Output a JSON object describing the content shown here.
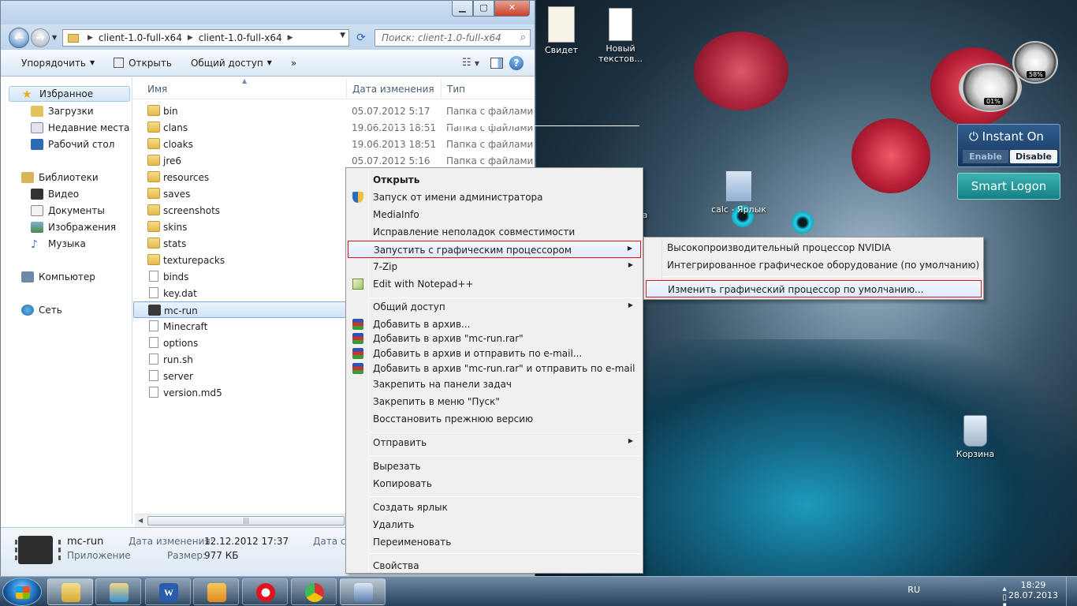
{
  "window": {
    "address": [
      "client-1.0-full-x64",
      "client-1.0-full-x64"
    ],
    "search_placeholder": "Поиск: client-1.0-full-x64",
    "controls": {
      "minimize": "▁",
      "maximize": "▢",
      "close": "✕"
    }
  },
  "toolbar": {
    "organize": "Упорядочить",
    "open": "Открыть",
    "share": "Общий доступ",
    "more": "»",
    "help": "?"
  },
  "nav": {
    "favorites": "Избранное",
    "downloads": "Загрузки",
    "recent": "Недавние места",
    "desktop": "Рабочий стол",
    "libraries": "Библиотеки",
    "video": "Видео",
    "documents": "Документы",
    "images": "Изображения",
    "music": "Музыка",
    "computer": "Компьютер",
    "network": "Сеть"
  },
  "columns": {
    "name": "Имя",
    "date": "Дата изменения",
    "type": "Тип"
  },
  "files": [
    {
      "name": "bin",
      "date": "05.07.2012 5:17",
      "type": "Папка с файлами",
      "kind": "folder"
    },
    {
      "name": "clans",
      "date": "19.06.2013 18:51",
      "type": "Папка с файлами",
      "kind": "folder"
    },
    {
      "name": "cloaks",
      "date": "19.06.2013 18:51",
      "type": "Папка с файлами",
      "kind": "folder"
    },
    {
      "name": "jre6",
      "date": "05.07.2012 5:16",
      "type": "Папка с файлами",
      "kind": "folder"
    },
    {
      "name": "resources",
      "date": "",
      "type": "",
      "kind": "folder"
    },
    {
      "name": "saves",
      "date": "",
      "type": "",
      "kind": "folder"
    },
    {
      "name": "screenshots",
      "date": "",
      "type": "",
      "kind": "folder"
    },
    {
      "name": "skins",
      "date": "",
      "type": "",
      "kind": "folder"
    },
    {
      "name": "stats",
      "date": "",
      "type": "",
      "kind": "folder"
    },
    {
      "name": "texturepacks",
      "date": "",
      "type": "",
      "kind": "folder"
    },
    {
      "name": "binds",
      "date": "",
      "type": "",
      "kind": "file"
    },
    {
      "name": "key.dat",
      "date": "",
      "type": "",
      "kind": "file"
    },
    {
      "name": "mc-run",
      "date": "",
      "type": "",
      "kind": "exe"
    },
    {
      "name": "Minecraft",
      "date": "",
      "type": "",
      "kind": "file"
    },
    {
      "name": "options",
      "date": "",
      "type": "",
      "kind": "file"
    },
    {
      "name": "run.sh",
      "date": "",
      "type": "",
      "kind": "file"
    },
    {
      "name": "server",
      "date": "",
      "type": "",
      "kind": "file"
    },
    {
      "name": "version.md5",
      "date": "",
      "type": "",
      "kind": "file"
    }
  ],
  "details": {
    "name": "mc-run",
    "kind": "Приложение",
    "modified_label": "Дата изменения:",
    "modified": "12.12.2012 17:37",
    "size_label": "Размер:",
    "size": "977 КБ",
    "created_label": "Дата со"
  },
  "context_menu": {
    "items": [
      {
        "label": "Открыть",
        "bold": true
      },
      {
        "label": "Запуск от имени администратора",
        "icon": "shield-icon"
      },
      {
        "label": "MediaInfo"
      },
      {
        "label": "Исправление неполадок совместимости"
      },
      {
        "label": "Запустить с графическим процессором",
        "submenu": true,
        "highlight": true
      },
      {
        "label": "7-Zip",
        "submenu": true
      },
      {
        "label": "Edit with Notepad++",
        "icon": "notepad-icon"
      },
      {
        "label": "Общий доступ",
        "submenu": true
      },
      {
        "label": "Добавить в архив...",
        "icon": "rar-icon"
      },
      {
        "label": "Добавить в архив \"mc-run.rar\"",
        "icon": "rar-icon"
      },
      {
        "label": "Добавить в архив и отправить по e-mail...",
        "icon": "rar-icon"
      },
      {
        "label": "Добавить в архив \"mc-run.rar\" и отправить по e-mail",
        "icon": "rar-icon"
      },
      {
        "label": "Закрепить на панели задач"
      },
      {
        "label": "Закрепить в меню \"Пуск\""
      },
      {
        "label": "Восстановить прежнюю версию"
      },
      {
        "label": "Отправить",
        "submenu": true
      },
      {
        "label": "Вырезать"
      },
      {
        "label": "Копировать"
      },
      {
        "label": "Создать ярлык"
      },
      {
        "label": "Удалить"
      },
      {
        "label": "Переименовать"
      },
      {
        "label": "Свойства"
      }
    ],
    "submenu_arrow": "▶"
  },
  "gpu_submenu": [
    {
      "label": "Высокопроизводительный процессор NVIDIA"
    },
    {
      "label": "Интегрированное графическое оборудование (по умолчанию)"
    },
    {
      "label": "Изменить графический процессор по умолчанию...",
      "highlight": true
    }
  ],
  "desktop": {
    "icons": {
      "certificate": "Свидет",
      "textfile": "Новый текстов...",
      "calc": "calc - Ярлык",
      "partial": "а",
      "recycle": "Корзина"
    },
    "gauges": {
      "cpu": "01%",
      "mem": "58%"
    },
    "instant_on": {
      "title": "Instant On",
      "enable": "Enable",
      "disable": "Disable"
    },
    "smart_logon": "Smart Logon"
  },
  "taskbar": {
    "lang": "RU",
    "time": "18:29",
    "date": "28.07.2013"
  },
  "colors": {
    "highlight_border": "#e3121c",
    "selection": "#cfe3f8"
  }
}
